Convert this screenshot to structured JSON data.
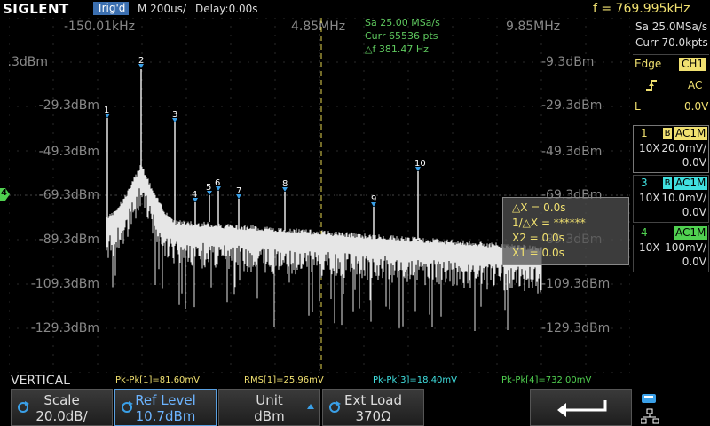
{
  "topbar": {
    "logo": "SIGLENT",
    "trigger_status": "Trig'd",
    "timebase": "M 200us/",
    "delay": "Delay:0.00s",
    "frequency": "f = 769.995kHz"
  },
  "screen": {
    "freq_labels": [
      "-150.01kHz",
      "4.85MHz",
      "9.85MHz"
    ],
    "db_labels": [
      "-9.3dBm",
      "-29.3dBm",
      "-49.3dBm",
      "-69.3dBm",
      "-89.3dBm",
      "-109.3dBm",
      "-129.3dBm"
    ],
    "info": [
      "Sa 25.00 MSa/s",
      "Curr 65536 pts",
      "△f 381.47 Hz"
    ],
    "markers": [
      "1",
      "2",
      "3",
      "4",
      "5",
      "6",
      "7",
      "8",
      "9",
      "10"
    ],
    "channel_marker": "4",
    "cursor_box": [
      "△X = 0.0s",
      "1/△X = ******",
      "X2 = 0.0s",
      "X1 = 0.0s"
    ]
  },
  "right_panel": {
    "sample_rate": "Sa 25.0MSa/s",
    "curr_pts": "Curr 70.0kpts",
    "trigger": {
      "type": "Edge",
      "source": "CH1",
      "coupling": "AC",
      "mode": "L",
      "level": "0.0V"
    },
    "channels": [
      {
        "num": "1",
        "flag": "B",
        "coupling": "AC1M",
        "probe": "10X",
        "scale": "20.0mV/",
        "offset": "0.0V"
      },
      {
        "num": "3",
        "flag": "B",
        "coupling": "AC1M",
        "probe": "10X",
        "scale": "10.0mV/",
        "offset": "0.0V"
      },
      {
        "num": "4",
        "flag": "",
        "coupling": "AC1M",
        "probe": "10X",
        "scale": "100mV/",
        "offset": "0.0V"
      }
    ]
  },
  "status": {
    "mode": "VERTICAL",
    "m1": "Pk-Pk[1]=81.60mV",
    "m2": "RMS[1]=25.96mV",
    "m3": "Pk-Pk[3]=18.40mV",
    "m4": "Pk-Pk[4]=732.00mV"
  },
  "softkeys": [
    {
      "title": "Scale",
      "value": "20.0dB/"
    },
    {
      "title": "Ref Level",
      "value": "10.7dBm"
    },
    {
      "title": "Unit",
      "value": "dBm"
    },
    {
      "title": "Ext Load",
      "value": "370Ω"
    }
  ],
  "colors": {
    "ch1": "#f0e070",
    "ch3": "#40e0e0",
    "ch4": "#50d050",
    "trig_badge": "#3b6fb0",
    "math": "#ffffff"
  }
}
